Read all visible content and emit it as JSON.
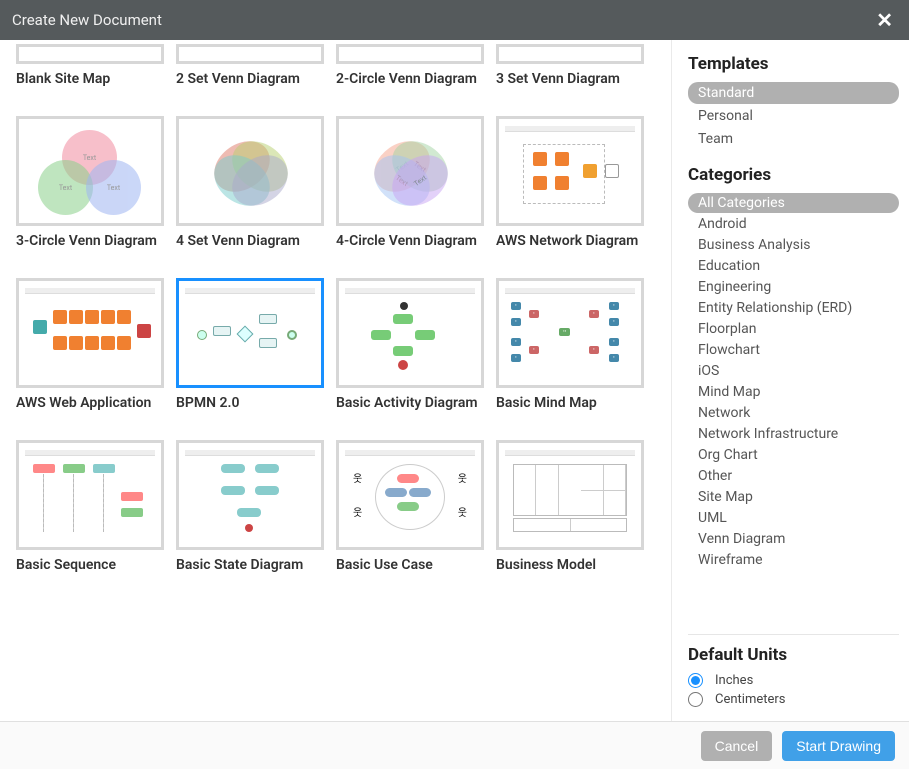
{
  "dialog_title": "Create New Document",
  "templates": [
    {
      "id": "blank-site-map",
      "label": "Blank Site Map",
      "thumb": "short"
    },
    {
      "id": "2-set-venn",
      "label": "2 Set Venn Diagram",
      "thumb": "short"
    },
    {
      "id": "2-circle-venn",
      "label": "2-Circle Venn Diagram",
      "thumb": "short"
    },
    {
      "id": "3-set-venn",
      "label": "3 Set Venn Diagram",
      "thumb": "short"
    },
    {
      "id": "3-circle-venn",
      "label": "3-Circle Venn Diagram",
      "thumb": "venn3"
    },
    {
      "id": "4-set-venn",
      "label": "4 Set Venn Diagram",
      "thumb": "venn4"
    },
    {
      "id": "4-circle-venn",
      "label": "4-Circle Venn Diagram",
      "thumb": "venn4b"
    },
    {
      "id": "aws-network",
      "label": "AWS Network Diagram",
      "thumb": "aws1"
    },
    {
      "id": "aws-web-app",
      "label": "AWS Web Application",
      "thumb": "aws2"
    },
    {
      "id": "bpmn-20",
      "label": "BPMN 2.0",
      "thumb": "bpmn",
      "selected": true
    },
    {
      "id": "basic-activity",
      "label": "Basic Activity Diagram",
      "thumb": "activity"
    },
    {
      "id": "basic-mind-map",
      "label": "Basic Mind Map",
      "thumb": "mind"
    },
    {
      "id": "basic-sequence",
      "label": "Basic Sequence",
      "thumb": "seq"
    },
    {
      "id": "basic-state",
      "label": "Basic State Diagram",
      "thumb": "state"
    },
    {
      "id": "basic-use-case",
      "label": "Basic Use Case",
      "thumb": "uc"
    },
    {
      "id": "business-model",
      "label": "Business Model",
      "thumb": "canvas"
    }
  ],
  "sidebar": {
    "templates_heading": "Templates",
    "template_groups": [
      {
        "label": "Standard",
        "active": true
      },
      {
        "label": "Personal"
      },
      {
        "label": "Team"
      }
    ],
    "categories_heading": "Categories",
    "categories": [
      {
        "label": "All Categories",
        "active": true
      },
      {
        "label": "Android"
      },
      {
        "label": "Business Analysis"
      },
      {
        "label": "Education"
      },
      {
        "label": "Engineering"
      },
      {
        "label": "Entity Relationship (ERD)"
      },
      {
        "label": "Floorplan"
      },
      {
        "label": "Flowchart"
      },
      {
        "label": "iOS"
      },
      {
        "label": "Mind Map"
      },
      {
        "label": "Network"
      },
      {
        "label": "Network Infrastructure"
      },
      {
        "label": "Org Chart"
      },
      {
        "label": "Other"
      },
      {
        "label": "Site Map"
      },
      {
        "label": "UML"
      },
      {
        "label": "Venn Diagram"
      },
      {
        "label": "Wireframe"
      }
    ],
    "units_heading": "Default Units",
    "units": [
      {
        "label": "Inches",
        "checked": true
      },
      {
        "label": "Centimeters",
        "checked": false
      }
    ]
  },
  "footer": {
    "cancel": "Cancel",
    "start": "Start Drawing"
  }
}
